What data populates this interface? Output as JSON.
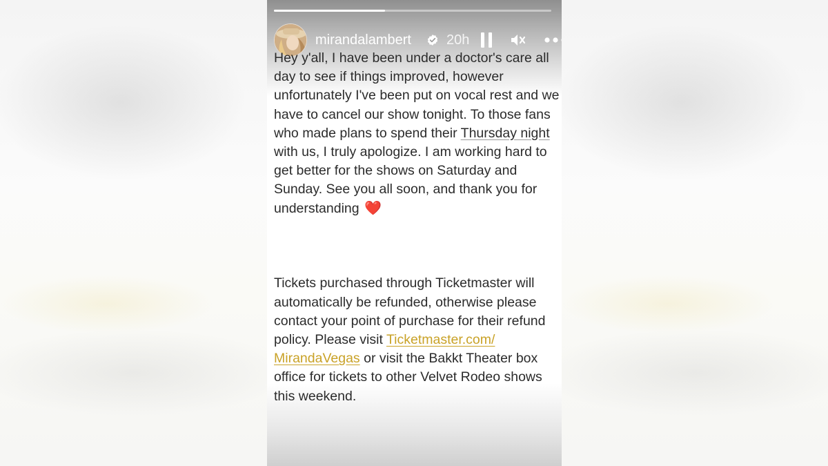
{
  "story": {
    "progress_fraction": 0.4,
    "header": {
      "username": "mirandalambert",
      "time": "20h"
    },
    "icons": {
      "verified": "verified-badge-icon",
      "pause": "pause-icon",
      "mute": "mute-icon",
      "more": "more-options-icon",
      "heart": "red-heart-emoji"
    },
    "message": {
      "p1_part1": "Hey y'all, I have been under a doctor's care all day to see if things improved, however unfortunately I've been put on vocal rest and we have to cancel our show tonight. To those fans who made plans to spend their",
      "p1_underlined": "Thursday night",
      "p1_part2": "with us, I truly apologize. I am working hard to get better for the shows on Saturday and Sunday. See you all soon, and thank you for understanding",
      "p1_heart": "❤️",
      "p2_part1": "Tickets purchased through Ticketmaster will automatically be refunded, otherwise please contact your point of purchase for their refund policy. Please visit",
      "p2_link": "Ticketmaster.com/ MirandaVegas",
      "p2_part2": "or visit the Bakkt Theater box office for tickets to other Velvet Rodeo shows this weekend."
    },
    "colors": {
      "link": "#c9a227",
      "heart": "#e0241b",
      "text": "#2b2b2b"
    }
  }
}
